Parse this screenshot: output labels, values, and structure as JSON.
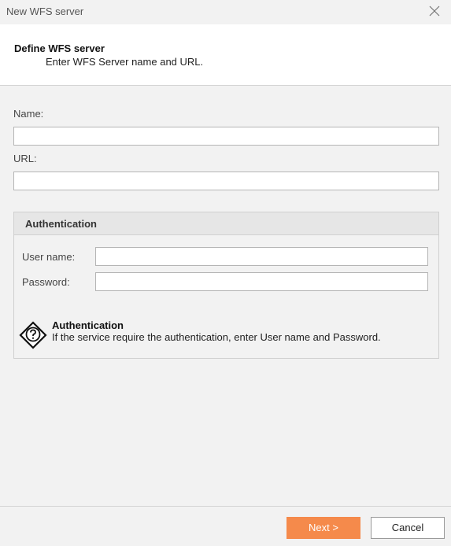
{
  "window": {
    "title": "New WFS server",
    "close_icon": "close-icon"
  },
  "header": {
    "title": "Define WFS server",
    "subtitle": "Enter WFS Server name and URL."
  },
  "form": {
    "name_label": "Name:",
    "name_value": "",
    "url_label": "URL:",
    "url_value": ""
  },
  "authentication": {
    "group_title": "Authentication",
    "username_label": "User name:",
    "username_value": "",
    "password_label": "Password:",
    "password_value": "",
    "info_icon": "help-diamond-icon",
    "info_title": "Authentication",
    "info_text": "If the service require the authentication, enter User name and Password."
  },
  "footer": {
    "next_label": "Next >",
    "cancel_label": "Cancel"
  },
  "colors": {
    "accent": "#f58a4b",
    "background": "#f2f2f2",
    "header_background": "#ffffff"
  }
}
